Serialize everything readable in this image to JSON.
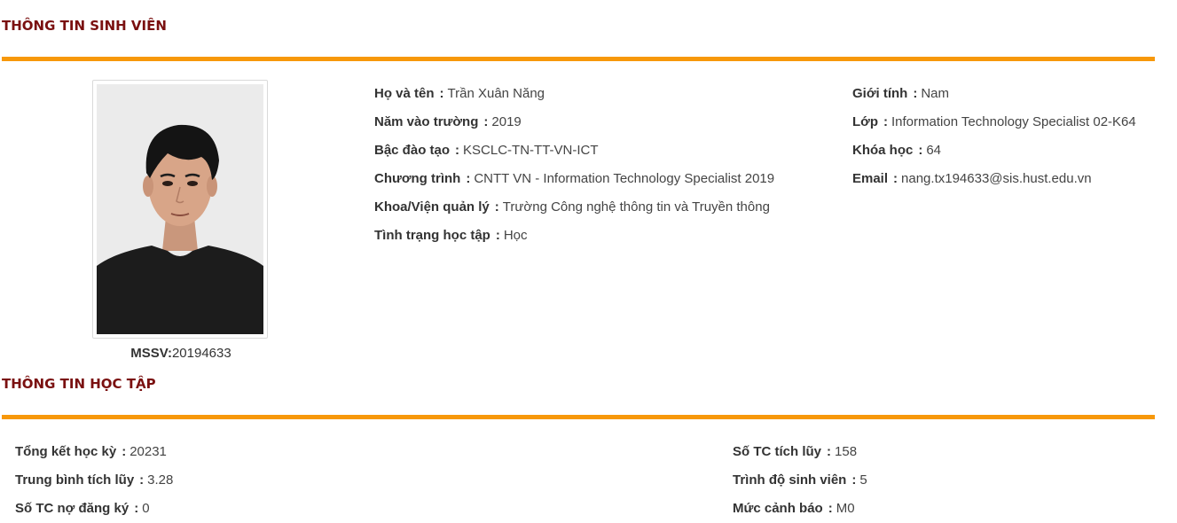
{
  "student_section": {
    "title": "THÔNG TIN SINH VIÊN",
    "photo": {
      "alt": "student-portrait"
    },
    "mssv_label": "MSSV:",
    "mssv_value": "20194633",
    "left_fields": [
      {
        "label": "Họ và tên",
        "value": "Trần Xuân Năng"
      },
      {
        "label": "Năm vào trường",
        "value": "2019"
      },
      {
        "label": "Bậc đào tạo",
        "value": "KSCLC-TN-TT-VN-ICT"
      },
      {
        "label": "Chương trình",
        "value": "CNTT VN - Information Technology Specialist 2019"
      },
      {
        "label": "Khoa/Viện quản lý",
        "value": "Trường Công nghệ thông tin và Truyền thông"
      },
      {
        "label": "Tình trạng học tập",
        "value": "Học"
      }
    ],
    "right_fields": [
      {
        "label": "Giới tính",
        "value": "Nam"
      },
      {
        "label": "Lớp",
        "value": "Information Technology Specialist 02-K64"
      },
      {
        "label": "Khóa học",
        "value": "64"
      },
      {
        "label": "Email",
        "value": "nang.tx194633@sis.hust.edu.vn"
      }
    ]
  },
  "study_section": {
    "title": "THÔNG TIN HỌC TẬP",
    "left_fields": [
      {
        "label": "Tổng kết học kỳ",
        "value": "20231"
      },
      {
        "label": "Trung bình tích lũy",
        "value": "3.28"
      },
      {
        "label": "Số TC nợ đăng ký",
        "value": "0"
      }
    ],
    "right_fields": [
      {
        "label": "Số TC tích lũy",
        "value": "158"
      },
      {
        "label": "Trình độ sinh viên",
        "value": "5"
      },
      {
        "label": "Mức cảnh báo",
        "value": "M0"
      }
    ]
  },
  "colors": {
    "accent_rule": "#f7980a",
    "section_title": "#7a1010"
  }
}
